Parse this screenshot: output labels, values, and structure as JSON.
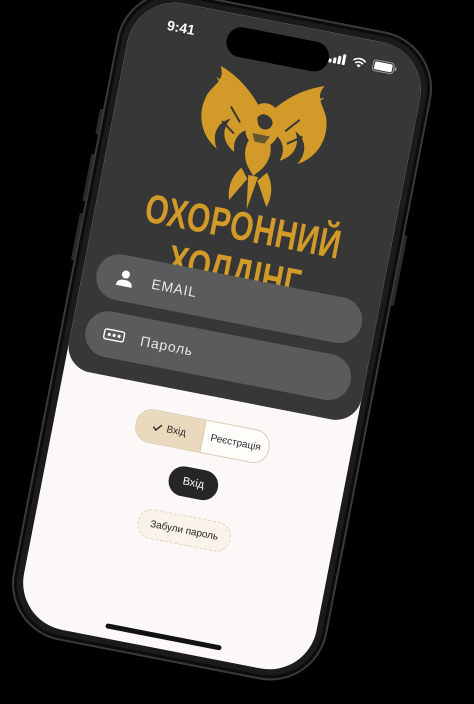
{
  "status_bar": {
    "time": "9:41",
    "icons": [
      "signal-icon",
      "wifi-icon",
      "battery-icon"
    ]
  },
  "brand": {
    "name": "ОХОРОННИЙ ХОЛДІНГ",
    "logo": "phoenix-logo-icon",
    "accent_color": "#d29a28"
  },
  "form": {
    "email_placeholder": "EMAIL",
    "email_icon": "user-icon",
    "password_placeholder": "Пароль",
    "password_icon": "password-dots-icon"
  },
  "auth_tabs": {
    "selected": "Вхід",
    "items": [
      {
        "label": "Вхід",
        "checked": true
      },
      {
        "label": "Реєстрація",
        "checked": false
      }
    ]
  },
  "buttons": {
    "login": "Вхід",
    "forgot_password": "Забули пароль"
  },
  "colors": {
    "panel": "#373737",
    "field": "#5b5b5b",
    "background": "#fcf8f8",
    "button_dark": "#262626"
  }
}
